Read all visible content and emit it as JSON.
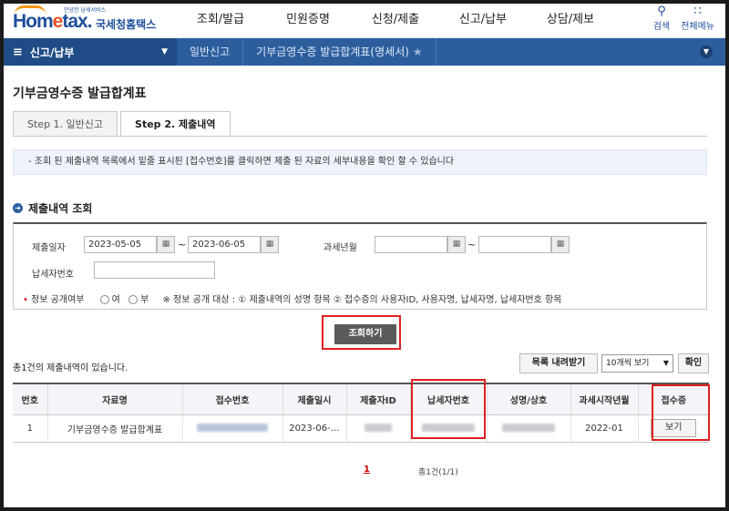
{
  "header": {
    "logo_sub": "안녕한 납세서비스",
    "logo_brand_1": "Hom",
    "logo_brand_2": "e",
    "logo_brand_3": "tax.",
    "logo_ko": "국세청홈택스",
    "menu": [
      "조회/발급",
      "민원증명",
      "신청/제출",
      "신고/납부",
      "상담/제보"
    ],
    "search_label": "검색",
    "allmenu_label": "전체메뉴"
  },
  "navbar": {
    "menu_label": "신고/납부",
    "crumbs": [
      "일반신고",
      "기부금영수증 발급합계표(명세서)"
    ]
  },
  "page_title": "기부금영수증 발급합계표",
  "tabs": [
    "Step 1. 일반신고",
    "Step 2. 제출내역"
  ],
  "notice": "- 조회 된 제출내역 목록에서 밑줄 표시된 [접수번호]를 클릭하면 제출 된 자료의 세부내용을 확인 할 수 있습니다",
  "section_title": "제출내역 조회",
  "search": {
    "submit_date_label": "제출일자",
    "date_from": "2023-05-05",
    "date_to": "2023-06-05",
    "tilde": "~",
    "tax_year_label": "과세년월",
    "taxpayer_no_label": "납세자번호",
    "disclosure_label": "정보 공개여부",
    "yes": "여",
    "no": "부",
    "disclosure_note": "※ 정보 공개 대상 : ① 제출내역의 성명 항목 ② 접수증의 사용자ID, 사용자명, 납세자명, 납세자번호 항목",
    "search_button": "조회하기"
  },
  "results": {
    "total_text": "총1건의 제출내역이 있습니다.",
    "download_button": "목록 내려받기",
    "page_size": "10개씩 보기",
    "ok_button": "확인",
    "columns": [
      "번호",
      "자료명",
      "접수번호",
      "제출일시",
      "제출자ID",
      "납세자번호",
      "성명/상호",
      "과세시작년월",
      "접수증"
    ],
    "rows": [
      {
        "no": "1",
        "name": "기부금영수증 발급합계표",
        "date": "2023-06-…",
        "start": "2022-01",
        "view": "보기"
      }
    ],
    "page": "1",
    "page_info": "총1건(1/1)"
  }
}
